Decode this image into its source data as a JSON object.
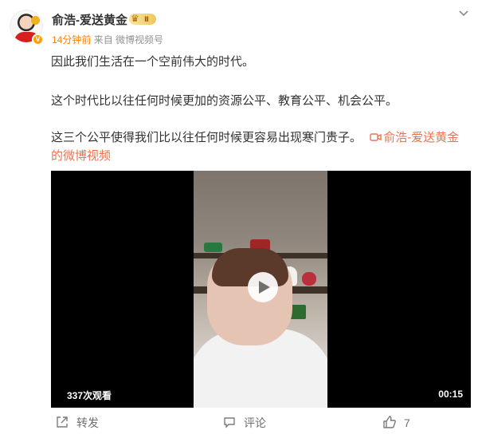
{
  "post": {
    "author": {
      "name": "俞浩-爱送黄金",
      "vip_level": "Ⅱ",
      "verified_badge": "V"
    },
    "meta": {
      "time": "14分钟前",
      "source": "来自 微博视频号"
    },
    "paragraphs": [
      "因此我们生活在一个空前伟大的时代。",
      "这个时代比以往任何时候更加的资源公平、教育公平、机会公平。",
      "这三个公平使得我们比以往任何时候更容易出现寒门贵子。"
    ],
    "video_link": "俞浩-爱送黄金的微博视频",
    "video": {
      "views": "337次观看",
      "duration": "00:15"
    },
    "actions": {
      "repost_label": "转发",
      "comment_label": "评论",
      "like_count": "7"
    }
  },
  "icons": {
    "more": "chevron-down-icon",
    "video_link": "video-camera-icon",
    "repost": "share-icon",
    "comment": "comment-icon",
    "like": "thumbs-up-icon",
    "play": "play-icon"
  },
  "colors": {
    "time_highlight": "#ff8200",
    "link": "#eb7350",
    "muted_text": "#939393",
    "vip_gold": "#f0c85b"
  }
}
